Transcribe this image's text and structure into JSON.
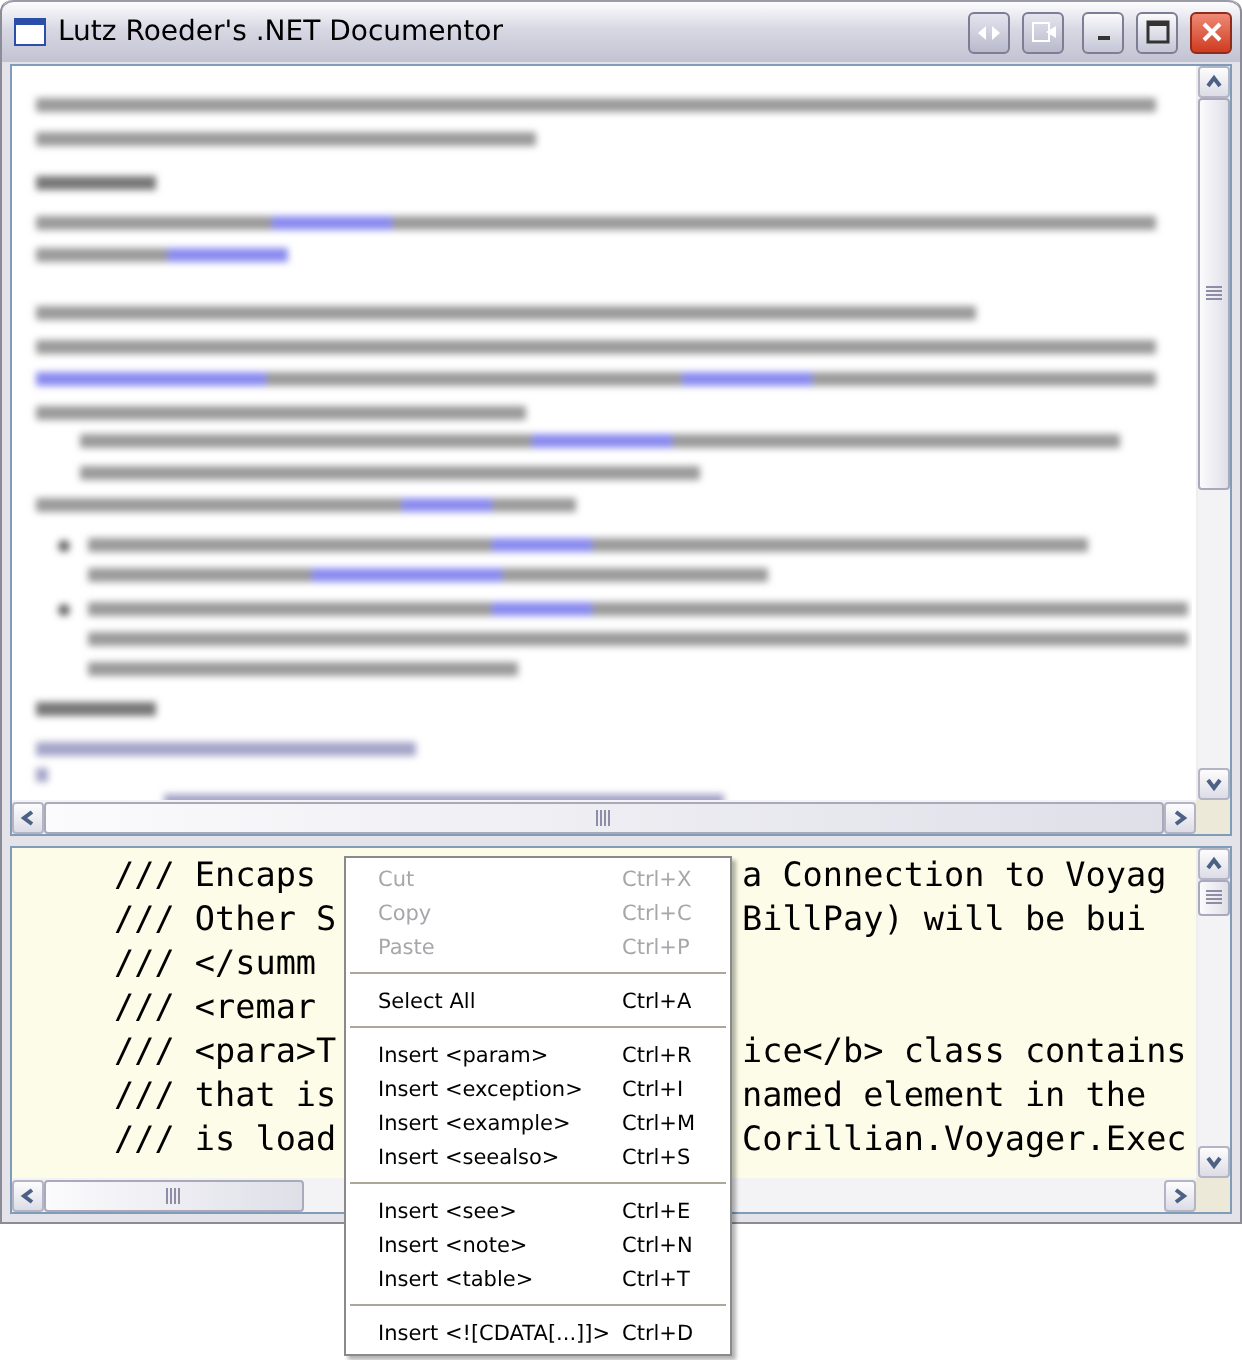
{
  "window": {
    "title": "Lutz Roeder's .NET Documentor"
  },
  "editor": {
    "lines": [
      {
        "left": "/// Encaps",
        "right": "a Connection to Voyag"
      },
      {
        "left": "/// Other S",
        "right": "BillPay) will be bui"
      },
      {
        "left": "/// </summ"
      },
      {
        "left": "/// <remar"
      },
      {
        "left": "/// <para>T",
        "right": "ice</b> class contains"
      },
      {
        "left": "/// that is",
        "right": "named element in the"
      },
      {
        "left": "/// is load",
        "right": "Corillian.Voyager.Exec"
      }
    ]
  },
  "context_menu": {
    "groups": [
      [
        {
          "label": "Cut",
          "shortcut": "Ctrl+X",
          "disabled": true
        },
        {
          "label": "Copy",
          "shortcut": "Ctrl+C",
          "disabled": true
        },
        {
          "label": "Paste",
          "shortcut": "Ctrl+P",
          "disabled": true
        }
      ],
      [
        {
          "label": "Select All",
          "shortcut": "Ctrl+A",
          "disabled": false
        }
      ],
      [
        {
          "label": "Insert <param>",
          "shortcut": "Ctrl+R",
          "disabled": false
        },
        {
          "label": "Insert <exception>",
          "shortcut": "Ctrl+I",
          "disabled": false
        },
        {
          "label": "Insert <example>",
          "shortcut": "Ctrl+M",
          "disabled": false
        },
        {
          "label": "Insert <seealso>",
          "shortcut": "Ctrl+S",
          "disabled": false
        }
      ],
      [
        {
          "label": "Insert <see>",
          "shortcut": "Ctrl+E",
          "disabled": false
        },
        {
          "label": "Insert <note>",
          "shortcut": "Ctrl+N",
          "disabled": false
        },
        {
          "label": "Insert <table>",
          "shortcut": "Ctrl+T",
          "disabled": false
        }
      ],
      [
        {
          "label": "Insert <![CDATA[...]]>",
          "shortcut": "Ctrl+D",
          "disabled": false
        }
      ]
    ]
  }
}
